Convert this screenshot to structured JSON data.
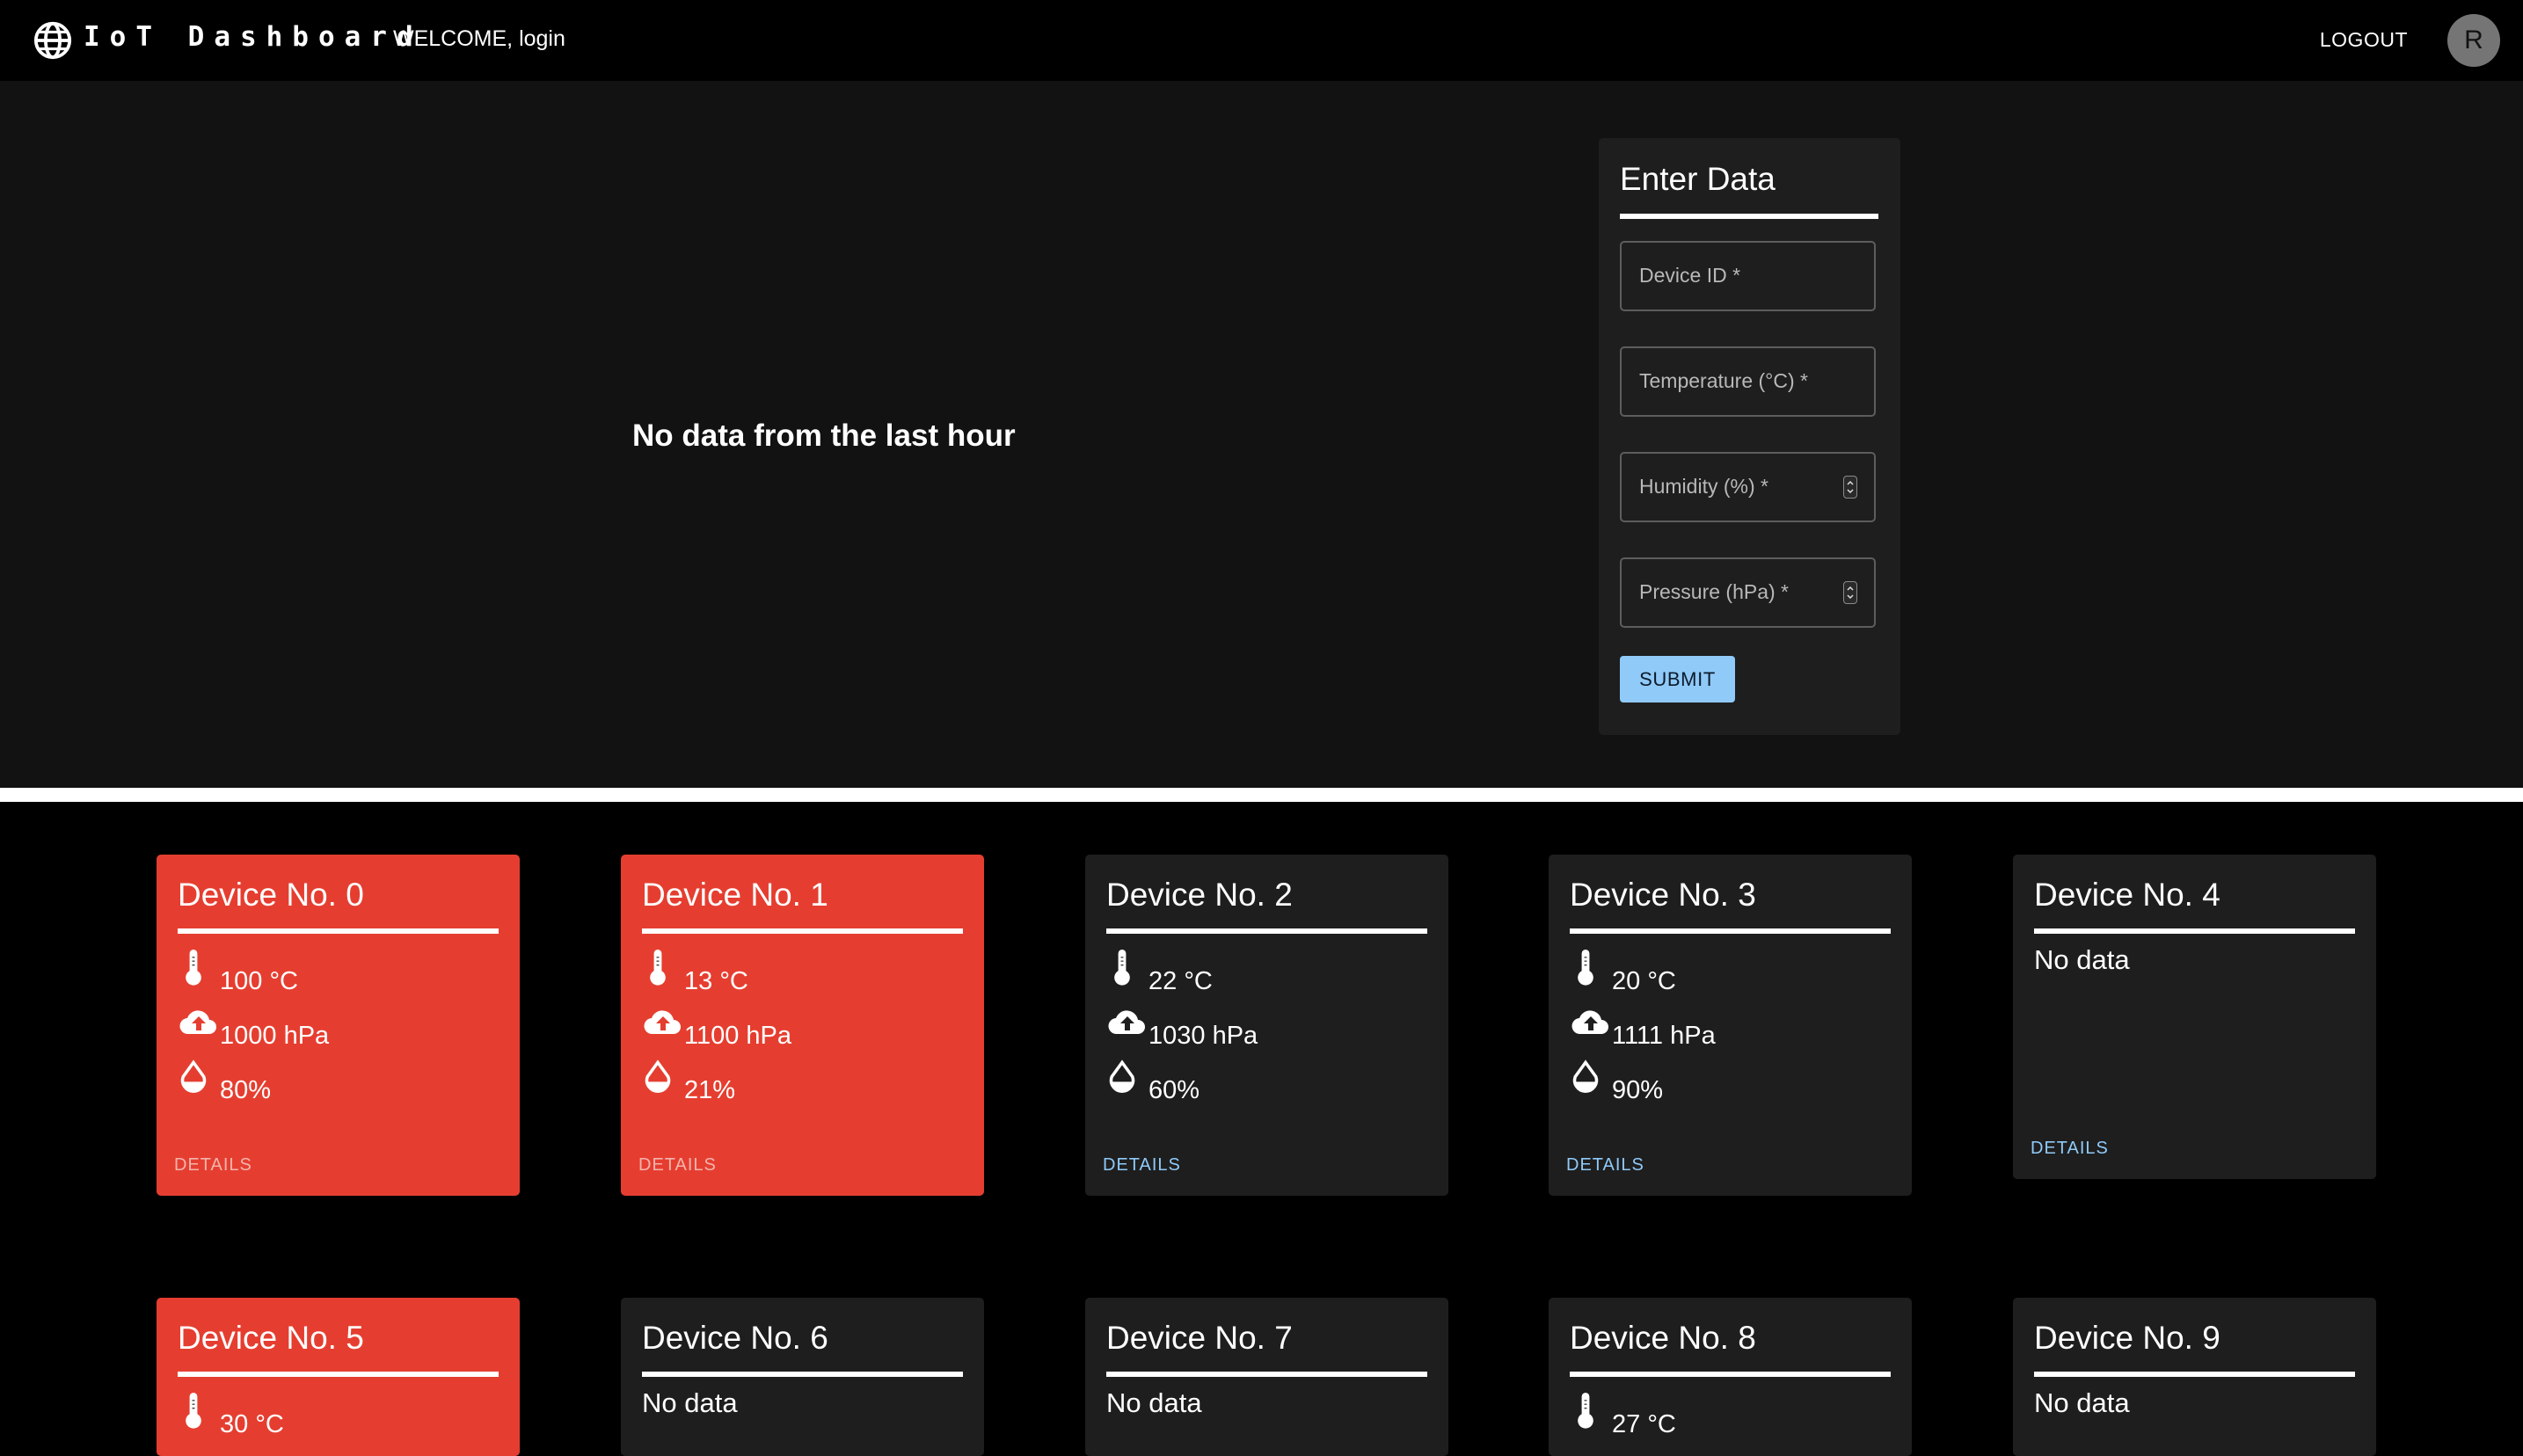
{
  "header": {
    "brand": "IoT Dashboard",
    "welcome": "WELCOME, login",
    "logout_label": "LOGOUT",
    "avatar_letter": "R"
  },
  "main": {
    "empty_message": "No data from the last hour"
  },
  "form": {
    "title": "Enter Data",
    "fields": [
      {
        "label": "Device ID *"
      },
      {
        "label": "Temperature (°C) *"
      },
      {
        "label": "Humidity (%) *"
      },
      {
        "label": "Pressure (hPa) *"
      }
    ],
    "submit_label": "SUBMIT"
  },
  "colors": {
    "alert_card": "#e53e30",
    "normal_card": "#1e1e1e",
    "accent": "#90caf9"
  },
  "devices": [
    {
      "title": "Device No. 0",
      "alert": true,
      "temperature": "100 °C",
      "pressure": "1000 hPa",
      "humidity": "80%",
      "details_label": "DETAILS"
    },
    {
      "title": "Device No. 1",
      "alert": true,
      "temperature": "13 °C",
      "pressure": "1100 hPa",
      "humidity": "21%",
      "details_label": "DETAILS"
    },
    {
      "title": "Device No. 2",
      "alert": false,
      "temperature": "22 °C",
      "pressure": "1030 hPa",
      "humidity": "60%",
      "details_label": "DETAILS"
    },
    {
      "title": "Device No. 3",
      "alert": false,
      "temperature": "20 °C",
      "pressure": "1111 hPa",
      "humidity": "90%",
      "details_label": "DETAILS"
    },
    {
      "title": "Device No. 4",
      "alert": false,
      "no_data": "No data",
      "details_label": "DETAILS"
    },
    {
      "title": "Device No. 5",
      "alert": true,
      "temperature": "30 °C"
    },
    {
      "title": "Device No. 6",
      "alert": false,
      "no_data": "No data"
    },
    {
      "title": "Device No. 7",
      "alert": false,
      "no_data": "No data"
    },
    {
      "title": "Device No. 8",
      "alert": false,
      "temperature": "27 °C"
    },
    {
      "title": "Device No. 9",
      "alert": false,
      "no_data": "No data"
    }
  ],
  "icons": {
    "app": "globe-icon",
    "temperature": "thermometer-icon",
    "pressure": "cloud-upload-icon",
    "humidity": "water-drop-icon"
  }
}
